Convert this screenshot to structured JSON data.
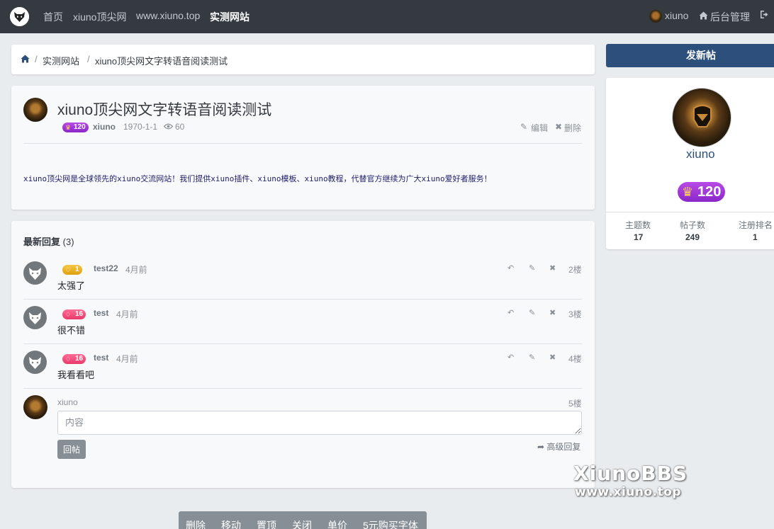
{
  "nav": {
    "items": [
      "首页",
      "xiuno顶尖网",
      "www.xiuno.top",
      "实测网站"
    ],
    "username": "xiuno",
    "admin_label": "后台管理",
    "truncated_label": "×"
  },
  "breadcrumb": {
    "section": "实测网站",
    "current": "xiuno顶尖网文字转语音阅读测试"
  },
  "thread": {
    "title": "xiuno顶尖网文字转语音阅读测试",
    "level": "120",
    "author": "xiuno",
    "date": "1970-1-1",
    "views": "60",
    "edit_label": "编辑",
    "delete_label": "删除",
    "body": "xiuno顶尖网是全球领先的xiuno交流网站！我们提供xiuno插件、xiuno模板、xiuno教程，代替官方继续为广大xiuno爱好者服务！"
  },
  "replies_section": {
    "heading": "最新回复",
    "count": "(3)",
    "replies": [
      {
        "level": "1",
        "badge_color": "#e8a317",
        "author": "test22",
        "time": "4月前",
        "content": "太强了",
        "floor": "2楼"
      },
      {
        "level": "16",
        "badge_color": "#f04a79",
        "author": "test",
        "time": "4月前",
        "content": "很不错",
        "floor": "3楼"
      },
      {
        "level": "16",
        "badge_color": "#f04a79",
        "author": "test",
        "time": "4月前",
        "content": "我看看吧",
        "floor": "4楼"
      }
    ],
    "compose": {
      "author": "xiuno",
      "floor": "5楼",
      "placeholder": "内容",
      "submit_label": "回帖",
      "advanced_label": "高级回复"
    }
  },
  "sidebar": {
    "new_thread_label": "发新帖",
    "profile": {
      "name": "xiuno",
      "level": "120",
      "stats": [
        {
          "label": "主题数",
          "value": "17"
        },
        {
          "label": "帖子数",
          "value": "249"
        },
        {
          "label": "注册排名",
          "value": "1"
        }
      ]
    }
  },
  "watermark": {
    "brand": "XiunoBBS",
    "url": "www.xiuno.top"
  },
  "admin_bar": {
    "items": [
      "删除",
      "移动",
      "置顶",
      "关闭",
      "单价",
      "5元购买字体"
    ]
  },
  "colors": {
    "navbar": "#343a40",
    "primary": "#2c4f7c",
    "level_purple": "#a63fd8"
  }
}
